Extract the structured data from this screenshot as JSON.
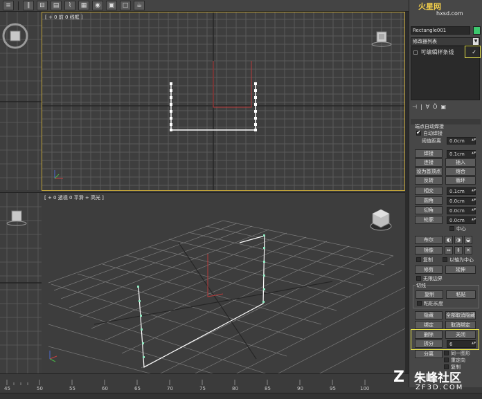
{
  "front_viewport": {
    "label": "[ + 0 前 0 线框 ]"
  },
  "persp_viewport": {
    "label": "[ + 0 透视 0 平滑 + 高光 ]"
  },
  "panel": {
    "object_name": "Rectangle001",
    "color_swatch": "#3cc86e",
    "modifier_list": "修改器列表",
    "stack_item": "可编辑样条线",
    "rollout_title": "端点自动焊接",
    "auto_weld": "自动焊接",
    "threshold_label": "阈值距离",
    "threshold_value": "0.0cm",
    "btn_weld": "焊接",
    "weld_value": "0.1cm",
    "btn_connect": "连接",
    "btn_insert": "插入",
    "btn_make_first": "设为首顶点",
    "btn_fuse": "熔合",
    "btn_reverse": "反转",
    "btn_cycle": "循环",
    "btn_intersect": "相交",
    "intersect_value": "0.1cm",
    "btn_fillet": "圆角",
    "fillet_value": "0.0cm",
    "btn_chamfer": "切角",
    "chamfer_value": "0.0cm",
    "btn_outline": "轮廓",
    "outline_value": "0.0cm",
    "center_label": "中心",
    "btn_boolean": "布尔",
    "btn_mirror": "镜像",
    "copy_label": "复制",
    "mirror_center_label": "以轴为中心",
    "btn_trim": "修剪",
    "btn_extend": "延伸",
    "infinite_label": "无限边界",
    "tangent_label": "切线",
    "btn_copy": "复制",
    "btn_paste": "粘贴",
    "paste_length_label": "粘贴长度",
    "btn_hide": "隐藏",
    "btn_unhide_all": "全部取消隐藏",
    "btn_bind": "绑定",
    "btn_unbind": "取消绑定",
    "btn_delete": "删除",
    "btn_close": "关闭",
    "btn_divide": "拆分",
    "divide_value": "6",
    "btn_detach": "分离",
    "same_shape_label": "同一图形",
    "reorient_label": "重定向",
    "detach_copy_label": "复制"
  },
  "timeline": {
    "ticks": [
      "45",
      "50",
      "55",
      "60",
      "65",
      "70",
      "75",
      "80",
      "85",
      "90",
      "95",
      "100"
    ]
  },
  "watermark": {
    "top_brand": "火星网",
    "top_url": "hxsd.com",
    "bottom_brand": "朱峰社区",
    "bottom_url": "ZF3D.COM"
  },
  "colors": {
    "highlight": "#e6e24a",
    "selected_segment": "#ffffff",
    "vertex": "#ffffff",
    "red_object": "#b83a3a"
  }
}
